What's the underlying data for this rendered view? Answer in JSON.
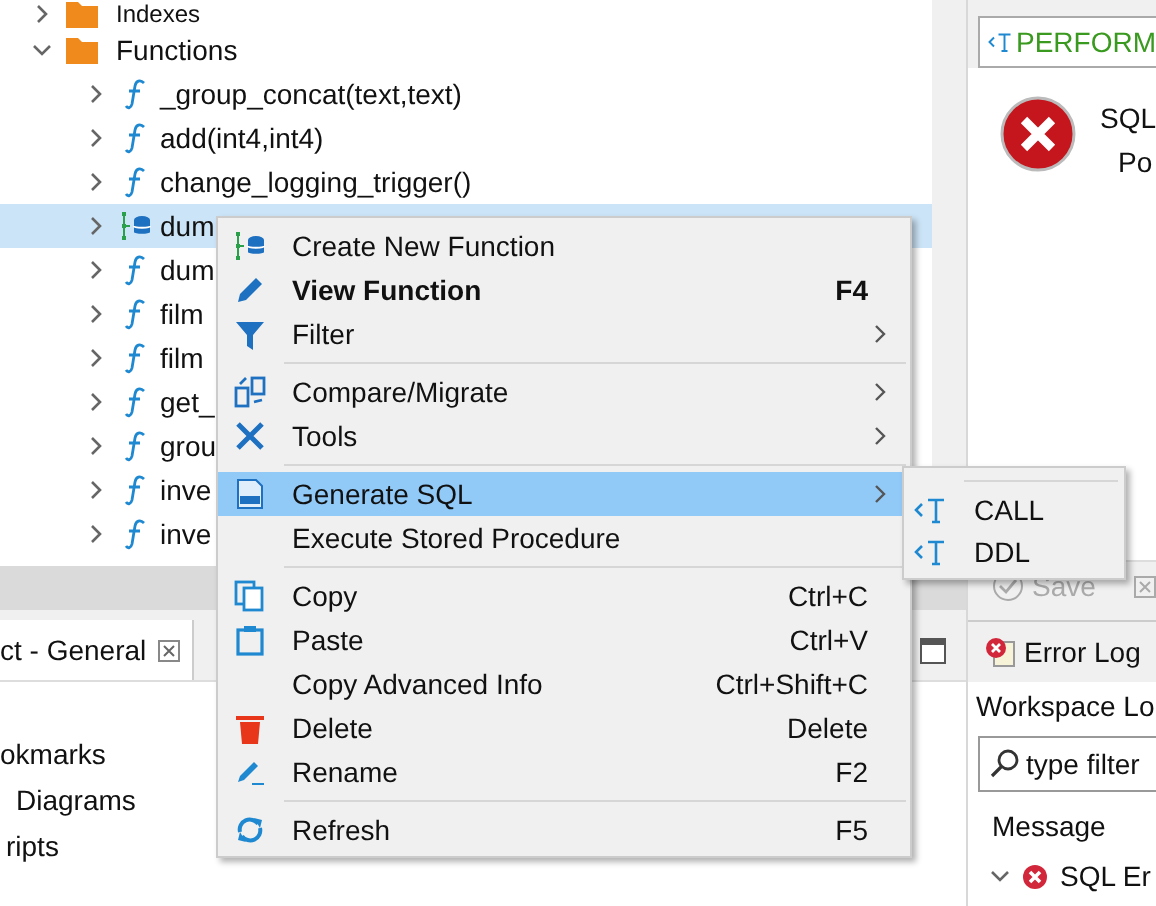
{
  "tree": {
    "items": [
      {
        "label": "Indexes",
        "kind": "folder",
        "expanded": false
      },
      {
        "label": "Functions",
        "kind": "folder",
        "expanded": true,
        "children": [
          {
            "label": "_group_concat(text,text)",
            "kind": "function",
            "selected": false
          },
          {
            "label": "add(int4,int4)",
            "kind": "function",
            "selected": false
          },
          {
            "label": "change_logging_trigger()",
            "kind": "function",
            "selected": false
          },
          {
            "label": "dum",
            "kind": "procedure",
            "selected": true
          },
          {
            "label": "dum",
            "kind": "function",
            "selected": false
          },
          {
            "label": "film",
            "kind": "function",
            "selected": false
          },
          {
            "label": "film",
            "kind": "function",
            "selected": false
          },
          {
            "label": "get_",
            "kind": "function",
            "selected": false
          },
          {
            "label": "grou",
            "kind": "function",
            "selected": false
          },
          {
            "label": "inve",
            "kind": "function",
            "selected": false
          },
          {
            "label": "inve",
            "kind": "function",
            "selected": false
          }
        ]
      }
    ]
  },
  "context_menu": {
    "items": [
      {
        "kind": "item",
        "label": "Create New Function",
        "selected": false
      },
      {
        "kind": "item",
        "label": "View Function",
        "shortcut": "F4",
        "default": true,
        "selected": false
      },
      {
        "kind": "item",
        "label": "Filter",
        "submenu": true,
        "selected": false
      },
      {
        "kind": "separator"
      },
      {
        "kind": "item",
        "label": "Compare/Migrate",
        "submenu": true,
        "selected": false
      },
      {
        "kind": "item",
        "label": "Tools",
        "submenu": true,
        "selected": false
      },
      {
        "kind": "separator"
      },
      {
        "kind": "item",
        "label": "Generate SQL",
        "submenu": true,
        "selected": true
      },
      {
        "kind": "item",
        "label": "Execute Stored Procedure",
        "selected": false
      },
      {
        "kind": "separator"
      },
      {
        "kind": "item",
        "label": "Copy",
        "shortcut": "Ctrl+C",
        "selected": false
      },
      {
        "kind": "item",
        "label": "Paste",
        "shortcut": "Ctrl+V",
        "selected": false
      },
      {
        "kind": "item",
        "label": "Copy Advanced Info",
        "shortcut": "Ctrl+Shift+C",
        "selected": false
      },
      {
        "kind": "item",
        "label": "Delete",
        "shortcut": "Delete",
        "selected": false
      },
      {
        "kind": "item",
        "label": "Rename",
        "shortcut": "F2",
        "selected": false
      },
      {
        "kind": "separator"
      },
      {
        "kind": "item",
        "label": "Refresh",
        "shortcut": "F5",
        "selected": false
      }
    ]
  },
  "submenu": {
    "items": [
      {
        "label": "CALL"
      },
      {
        "label": "DDL"
      }
    ]
  },
  "bottom_left": {
    "tab": {
      "label": "ct - General"
    },
    "items": [
      "okmarks",
      "Diagrams",
      "ripts"
    ]
  },
  "results": {
    "query": "PERFORM",
    "message_lines": [
      "SQL",
      "Po"
    ],
    "save_button": {
      "label": "Save",
      "disabled": true
    }
  },
  "error_log": {
    "tab": "Error Log",
    "subtitle": "Workspace Lo",
    "filter": {
      "value": "type filter"
    },
    "column": "Message",
    "rows": [
      {
        "label": "SQL Er",
        "expanded": true
      }
    ]
  }
}
